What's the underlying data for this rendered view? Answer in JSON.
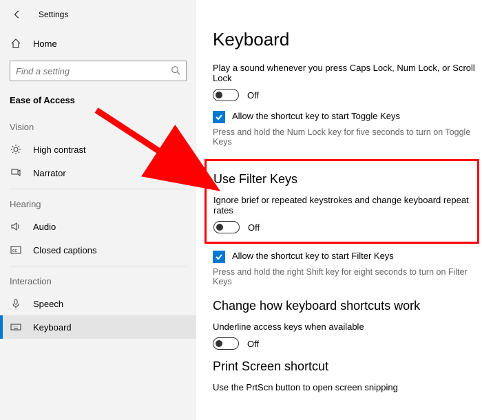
{
  "header": {
    "app_name": "Settings"
  },
  "sidebar": {
    "home_label": "Home",
    "search_placeholder": "Find a setting",
    "section_title": "Ease of Access",
    "groups": {
      "vision": "Vision",
      "hearing": "Hearing",
      "interaction": "Interaction"
    },
    "items": {
      "high_contrast": "High contrast",
      "narrator": "Narrator",
      "audio": "Audio",
      "closed_captions": "Closed captions",
      "speech": "Speech",
      "keyboard": "Keyboard"
    }
  },
  "main": {
    "title": "Keyboard",
    "caps_sound": "Play a sound whenever you press Caps Lock, Num Lock, or Scroll Lock",
    "off_label": "Off",
    "toggle_keys_checkbox": "Allow the shortcut key to start Toggle Keys",
    "toggle_keys_help": "Press and hold the Num Lock key for five seconds to turn on Toggle Keys",
    "filter_heading": "Use Filter Keys",
    "filter_desc": "Ignore brief or repeated keystrokes and change keyboard repeat rates",
    "filter_checkbox": "Allow the shortcut key to start Filter Keys",
    "filter_help": "Press and hold the right Shift key for eight seconds to turn on Filter Keys",
    "shortcuts_heading": "Change how keyboard shortcuts work",
    "underline_text": "Underline access keys when available",
    "printscreen_heading": "Print Screen shortcut",
    "printscreen_text": "Use the PrtScn button to open screen snipping"
  }
}
